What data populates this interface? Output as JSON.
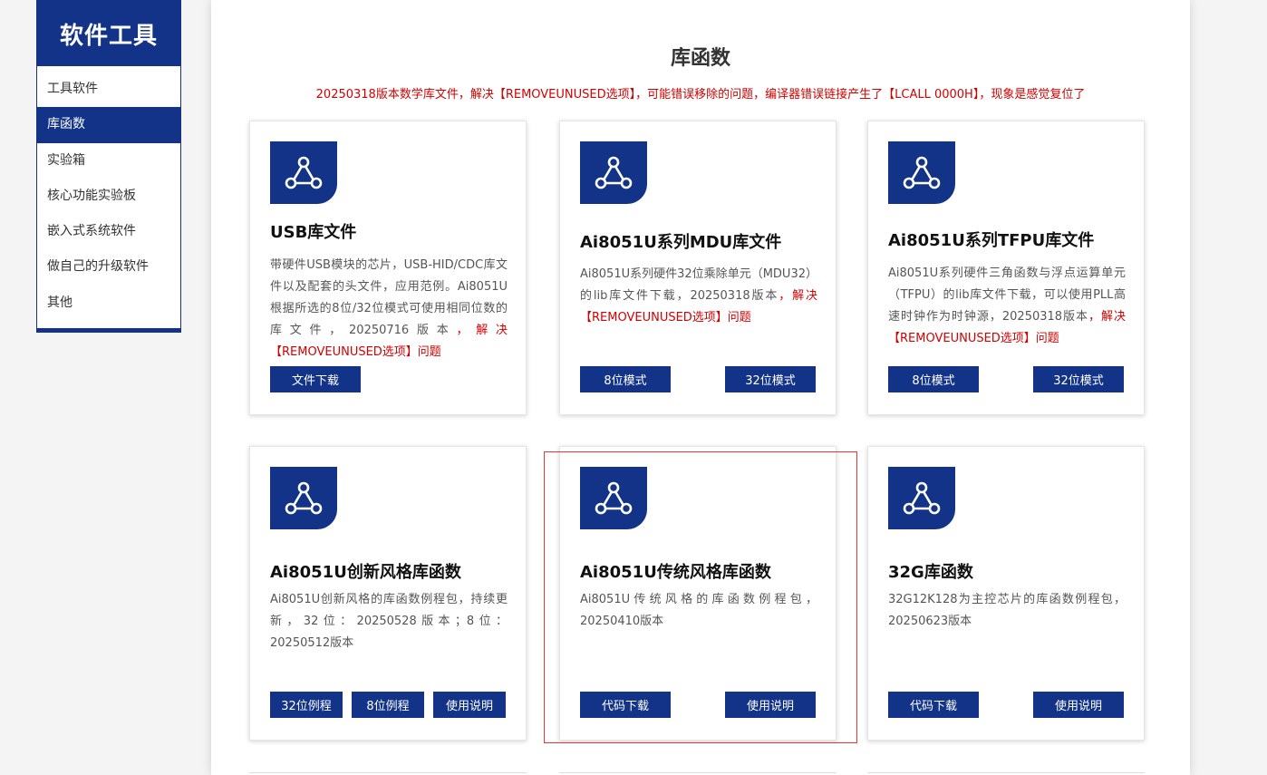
{
  "sidebar": {
    "title": "软件工具",
    "items": [
      {
        "label": "工具软件"
      },
      {
        "label": "库函数"
      },
      {
        "label": "实验箱"
      },
      {
        "label": "核心功能实验板"
      },
      {
        "label": "嵌入式系统软件"
      },
      {
        "label": "做自己的升级软件"
      },
      {
        "label": "其他"
      }
    ],
    "active_index": 1
  },
  "main": {
    "title": "库函数",
    "notice": "20250318版本数学库文件，解决【REMOVEUNUSED选项】，可能错误移除的问题，编译器错误链接产生了【LCALL  0000H】，现象是感觉复位了"
  },
  "cards": [
    {
      "title": "USB库文件",
      "desc": "带硬件USB模块的芯片，USB-HID/CDC库文件以及配套的头文件，应用范例。Ai8051U根据所选的8位/32位模式可使用相同位数的库文件，20250716版本",
      "desc_red": "，解决【REMOVEUNUSED选项】问题",
      "buttons": [
        "文件下载"
      ]
    },
    {
      "title": "Ai8051U系列MDU库文件",
      "desc": "Ai8051U系列硬件32位乘除单元（MDU32）的lib库文件下载，20250318版本",
      "desc_red": "，解决【REMOVEUNUSED选项】问题",
      "buttons": [
        "8位模式",
        "32位模式"
      ]
    },
    {
      "title": "Ai8051U系列TFPU库文件",
      "desc": "Ai8051U系列硬件三角函数与浮点运算单元（TFPU）的lib库文件下载，可以使用PLL高速时钟作为时钟源，20250318版本",
      "desc_red": "，解决【REMOVEUNUSED选项】问题",
      "buttons": [
        "8位模式",
        "32位模式"
      ]
    },
    {
      "title": "Ai8051U创新风格库函数",
      "desc": "Ai8051U创新风格的库函数例程包，持续更新，32位：20250528版本；8位：20250512版本",
      "desc_red": "",
      "buttons": [
        "32位例程",
        "8位例程",
        "使用说明"
      ]
    },
    {
      "title": "Ai8051U传统风格库函数",
      "desc": "Ai8051U传统风格的库函数例程包，20250410版本",
      "desc_red": "",
      "buttons": [
        "代码下载",
        "使用说明"
      ]
    },
    {
      "title": "32G库函数",
      "desc": "32G12K128为主控芯片的库函数例程包，20250623版本",
      "desc_red": "",
      "buttons": [
        "代码下载",
        "使用说明"
      ]
    }
  ],
  "icons": {
    "card_icon": "share-network-icon"
  },
  "colors": {
    "brand": "#123387",
    "notice": "#d30000",
    "highlight": "#e33333"
  }
}
